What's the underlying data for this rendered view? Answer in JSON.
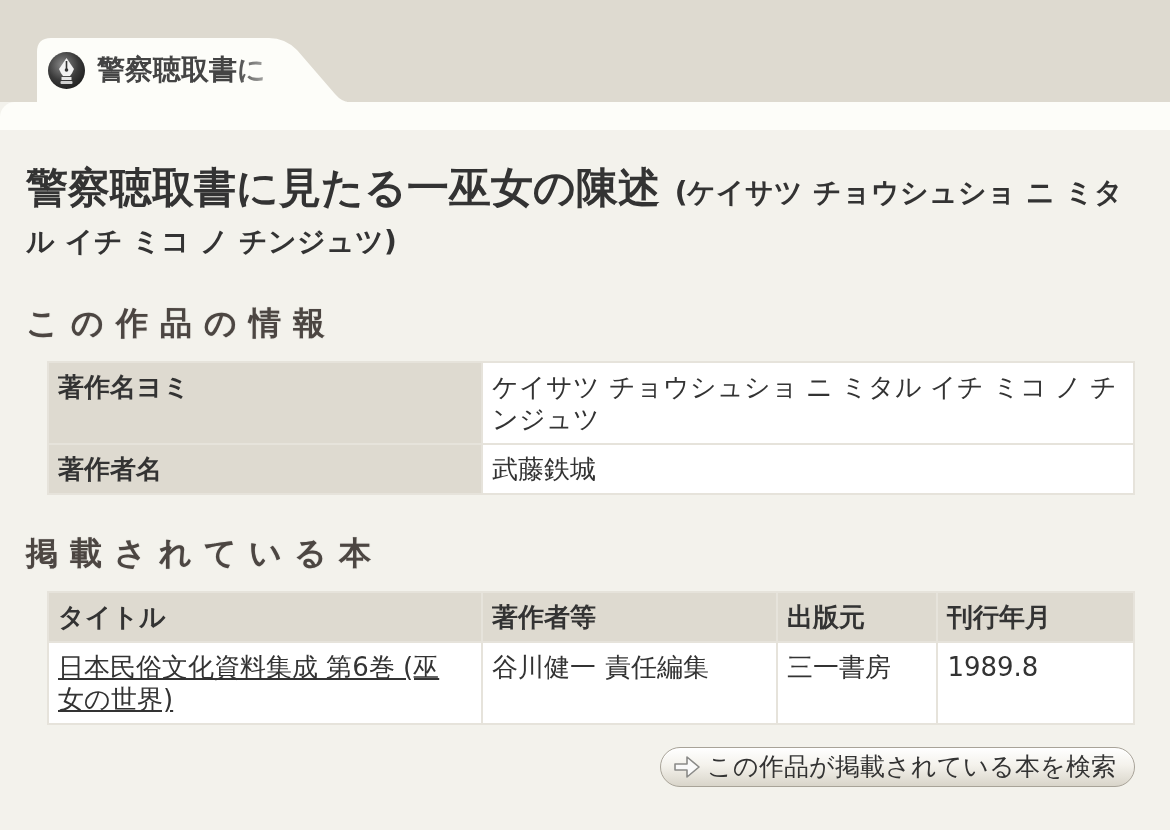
{
  "tab": {
    "label": "警察聴取書に"
  },
  "title": {
    "main": "警察聴取書に見たる一巫女の陳述",
    "reading": "(ケイサツ チョウシュショ ニ ミタル イチ ミコ ノ チンジュツ)"
  },
  "work_info": {
    "heading": "この作品の情報",
    "rows": [
      {
        "label": "著作名ヨミ",
        "value": "ケイサツ チョウシュショ ニ ミタル イチ ミコ ノ チンジュツ"
      },
      {
        "label": "著作者名",
        "value": "武藤鉄城"
      }
    ]
  },
  "books": {
    "heading": "掲載されている本",
    "columns": [
      "タイトル",
      "著作者等",
      "出版元",
      "刊行年月"
    ],
    "rows": [
      {
        "title": "日本民俗文化資料集成 第6巻 (巫女の世界)",
        "author": "谷川健一 責任編集",
        "publisher": "三一書房",
        "date": "1989.8"
      }
    ]
  },
  "search_button": {
    "label": "この作品が掲載されている本を検索"
  }
}
